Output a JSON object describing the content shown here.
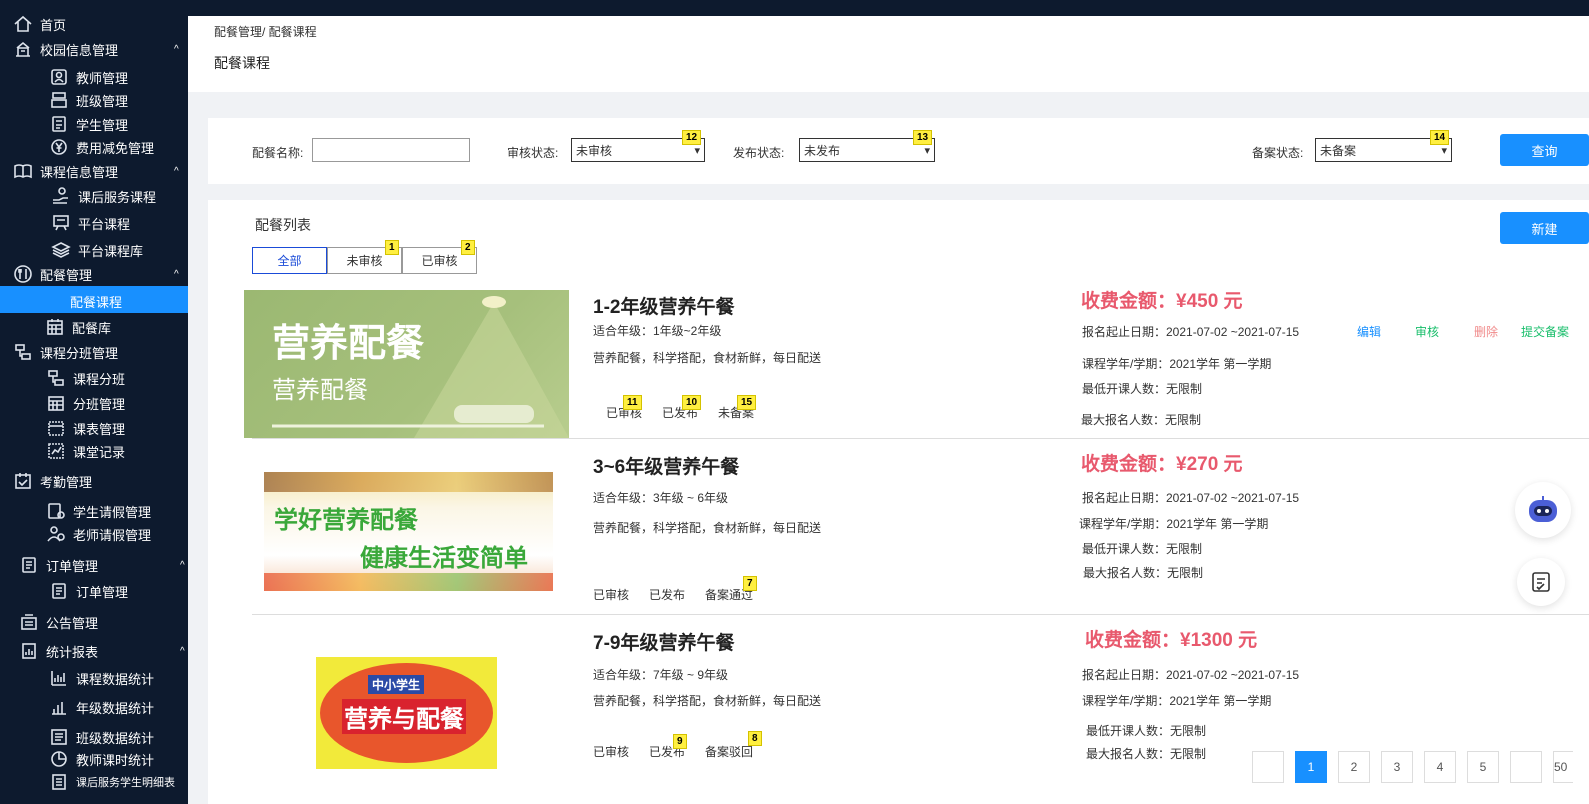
{
  "sidebar": {
    "items": [
      {
        "label": "首页",
        "icon": "home-icon"
      },
      {
        "label": "校园信息管理",
        "icon": "school-icon",
        "caret": "^"
      },
      {
        "label": "教师管理",
        "icon": "teacher-icon"
      },
      {
        "label": "班级管理",
        "icon": "class-icon"
      },
      {
        "label": "学生管理",
        "icon": "student-icon"
      },
      {
        "label": "费用减免管理",
        "icon": "yen-icon"
      },
      {
        "label": "课程信息管理",
        "icon": "book-icon",
        "caret": "^"
      },
      {
        "label": "课后服务课程",
        "icon": "hand-service-icon"
      },
      {
        "label": "平台课程",
        "icon": "board-icon"
      },
      {
        "label": "平台课程库",
        "icon": "layers-icon"
      },
      {
        "label": "配餐管理",
        "icon": "utensils-icon",
        "caret": "^"
      },
      {
        "label": "配餐课程",
        "icon": ""
      },
      {
        "label": "配餐库",
        "icon": "calendar-grid-icon"
      },
      {
        "label": "课程分班管理",
        "icon": "split-icon"
      },
      {
        "label": "课程分班",
        "icon": "split-icon"
      },
      {
        "label": "分班管理",
        "icon": "calendar-grid-icon"
      },
      {
        "label": "课表管理",
        "icon": "timetable-icon"
      },
      {
        "label": "课堂记录",
        "icon": "record-icon"
      },
      {
        "label": "考勤管理",
        "icon": "attendance-icon"
      },
      {
        "label": "学生请假管理",
        "icon": "leave-icon"
      },
      {
        "label": "老师请假管理",
        "icon": "teacher-leave-icon"
      },
      {
        "label": "订单管理",
        "icon": "order-icon",
        "caret": "^"
      },
      {
        "label": "订单管理",
        "icon": "order-icon"
      },
      {
        "label": "公告管理",
        "icon": "notice-icon"
      },
      {
        "label": "统计报表",
        "icon": "report-icon",
        "caret": "^"
      },
      {
        "label": "课程数据统计",
        "icon": "chart-icon"
      },
      {
        "label": "年级数据统计",
        "icon": "bar-icon"
      },
      {
        "label": "班级数据统计",
        "icon": "list-chart-icon"
      },
      {
        "label": "教师课时统计",
        "icon": "pie-icon"
      },
      {
        "label": "课后服务学生明细表",
        "icon": "detail-icon"
      }
    ]
  },
  "header": {
    "breadcrumb": "配餐管理/ 配餐课程",
    "title": "配餐课程"
  },
  "filter": {
    "name_label": "配餐名称:",
    "name_value": "",
    "audit_label": "审核状态:",
    "audit_value": "未审核",
    "audit_tag": "12",
    "publish_label": "发布状态:",
    "publish_value": "未发布",
    "publish_tag": "13",
    "record_label": "备案状态:",
    "record_value": "未备案",
    "record_tag": "14",
    "query_label": "查询"
  },
  "list": {
    "title": "配餐列表",
    "new_label": "新建",
    "tabs": [
      {
        "label": "全部",
        "tag": ""
      },
      {
        "label": "未审核",
        "tag": "1"
      },
      {
        "label": "已审核",
        "tag": "2"
      }
    ],
    "courses": [
      {
        "name": "1-2年级营养午餐",
        "grade": "适合年级：1年级~2年级",
        "desc": "营养配餐，科学搭配，食材新鲜，每日配送",
        "status": [
          "已审核",
          "已发布",
          "未备案"
        ],
        "status_tags": [
          "11",
          "10",
          "15"
        ],
        "fee": "收费金额：¥450 元",
        "date": "报名起止日期：2021-07-02 ~2021-07-15",
        "term": "课程学年/学期：2021学年 第一学期",
        "min": "最低开课人数：无限制",
        "max": "最大报名人数：无限制",
        "thumb_title": "营养配餐",
        "thumb_sub": "营养配餐",
        "ops": [
          "编辑",
          "审核",
          "删除",
          "提交备案"
        ]
      },
      {
        "name": "3~6年级营养午餐",
        "grade": "适合年级：3年级 ~ 6年级",
        "desc": "营养配餐，科学搭配，食材新鲜，每日配送",
        "status": [
          "已审核",
          "已发布",
          "备案通过"
        ],
        "status_tags": [
          "",
          "",
          "7"
        ],
        "fee": "收费金额：¥270 元",
        "date": "报名起止日期：2021-07-02 ~2021-07-15",
        "term": "课程学年/学期：2021学年 第一学期",
        "min": "最低开课人数：无限制",
        "max": "最大报名人数：无限制",
        "thumb_title": "学好营养配餐",
        "thumb_sub": "健康生活变简单"
      },
      {
        "name": "7-9年级营养午餐",
        "grade": "适合年级：7年级 ~ 9年级",
        "desc": "营养配餐，科学搭配，食材新鲜，每日配送",
        "status": [
          "已审核",
          "已发布",
          "备案驳回"
        ],
        "status_tags": [
          "",
          "9",
          "8"
        ],
        "fee": "收费金额：¥1300 元",
        "date": "报名起止日期：2021-07-02 ~2021-07-15",
        "term": "课程学年/学期：2021学年 第一学期",
        "min": "最低开课人数：无限制",
        "max": "最大报名人数：无限制",
        "thumb_top": "中小学生",
        "thumb_title": "营养与配餐"
      }
    ]
  },
  "pagination": {
    "prev": "",
    "pages": [
      "1",
      "2",
      "3",
      "4",
      "5"
    ],
    "next": "",
    "last": "50",
    "current": "1"
  },
  "colors": {
    "sidebar_bg": "#0d1a2e",
    "accent": "#1890ff",
    "fee": "#e8596d",
    "edit": "#1890ff",
    "audit": "#19be6b",
    "delete": "#f08a8a",
    "submit": "#19be6b"
  }
}
